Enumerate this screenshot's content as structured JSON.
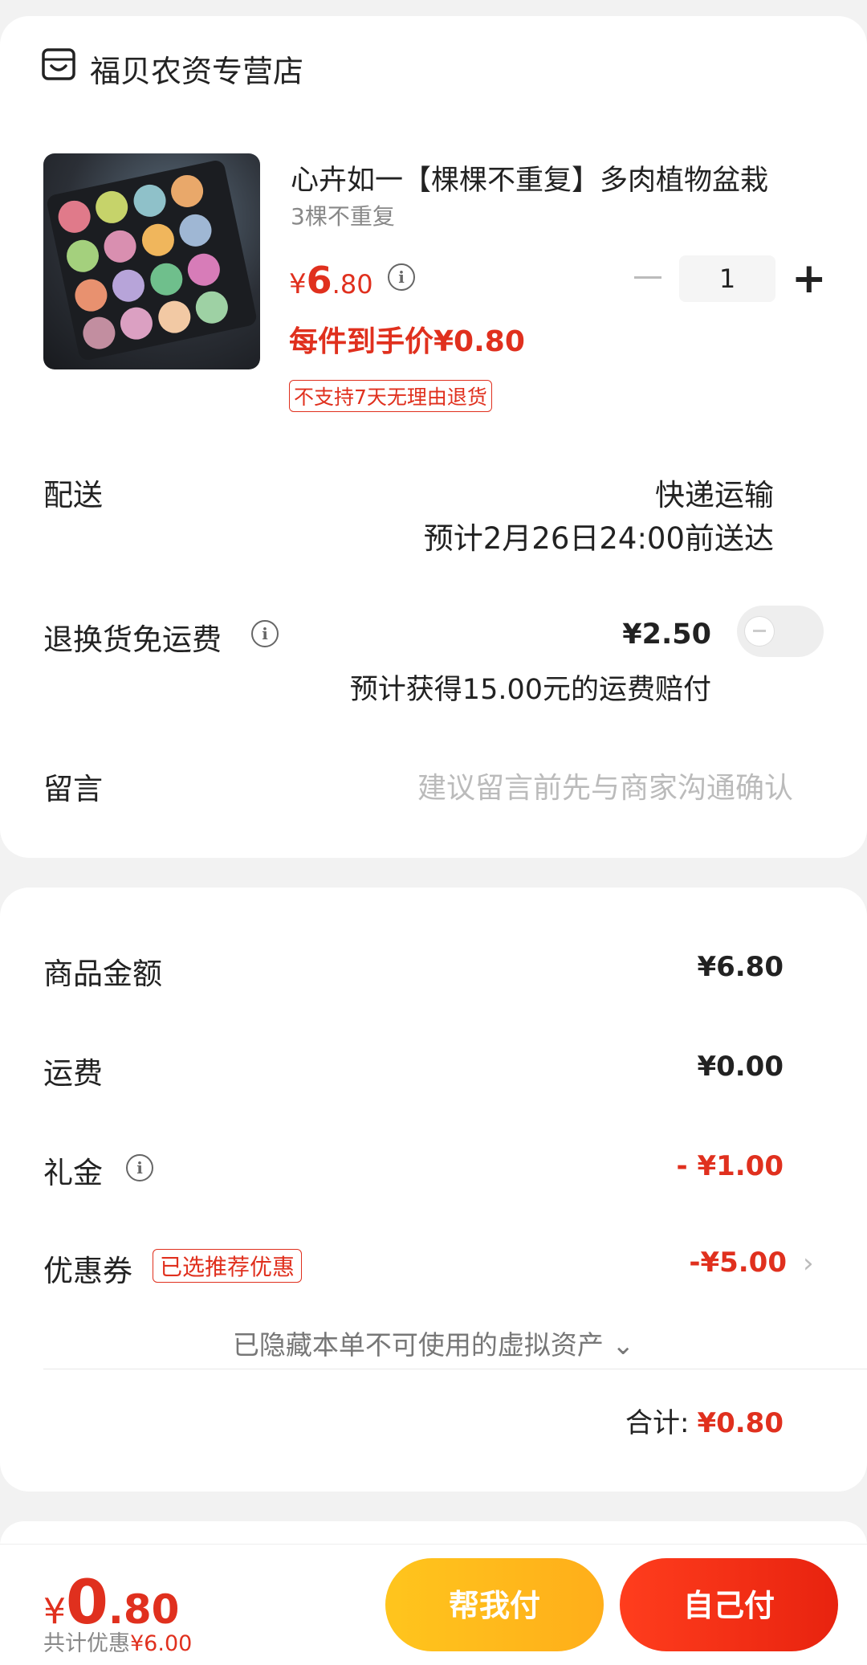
{
  "store": {
    "name": "福贝农资专营店",
    "icon": "store-icon"
  },
  "product": {
    "title": "心卉如一【棵棵不重复】多肉植物盆栽",
    "variant": "3棵不重复",
    "price_currency": "¥",
    "price_int": "6",
    "price_dec": ".80",
    "each_price": "每件到手价¥0.80",
    "return_tag": "不支持7天无理由退货",
    "quantity": "1"
  },
  "delivery": {
    "label": "配送",
    "method": "快递运输",
    "eta": "预计2月26日24:00前送达"
  },
  "return_shipping": {
    "label": "退换货免运费",
    "price": "¥2.50",
    "note": "预计获得15.00元的运费赔付",
    "toggle_on": false
  },
  "message": {
    "label": "留言",
    "placeholder": "建议留言前先与商家沟通确认"
  },
  "summary": {
    "goods_label": "商品金额",
    "goods_value": "¥6.80",
    "shipping_label": "运费",
    "shipping_value": "¥0.00",
    "gift_label": "礼金",
    "gift_value": "- ¥1.00",
    "coupon_label": "优惠券",
    "coupon_tag": "已选推荐优惠",
    "coupon_value": "-¥5.00",
    "hidden_assets": "已隐藏本单不可使用的虚拟资产",
    "total_label": "合计:",
    "total_value": "¥0.80"
  },
  "bottom": {
    "total_currency": "¥",
    "total_int": "0",
    "total_dec": ".80",
    "saved": "共计优惠¥6.00",
    "help_pay": "帮我付",
    "self_pay": "自己付"
  },
  "colors": {
    "accent": "#e0301e",
    "help_btn": "#ffbb1c",
    "self_btn": "#f52f17"
  }
}
